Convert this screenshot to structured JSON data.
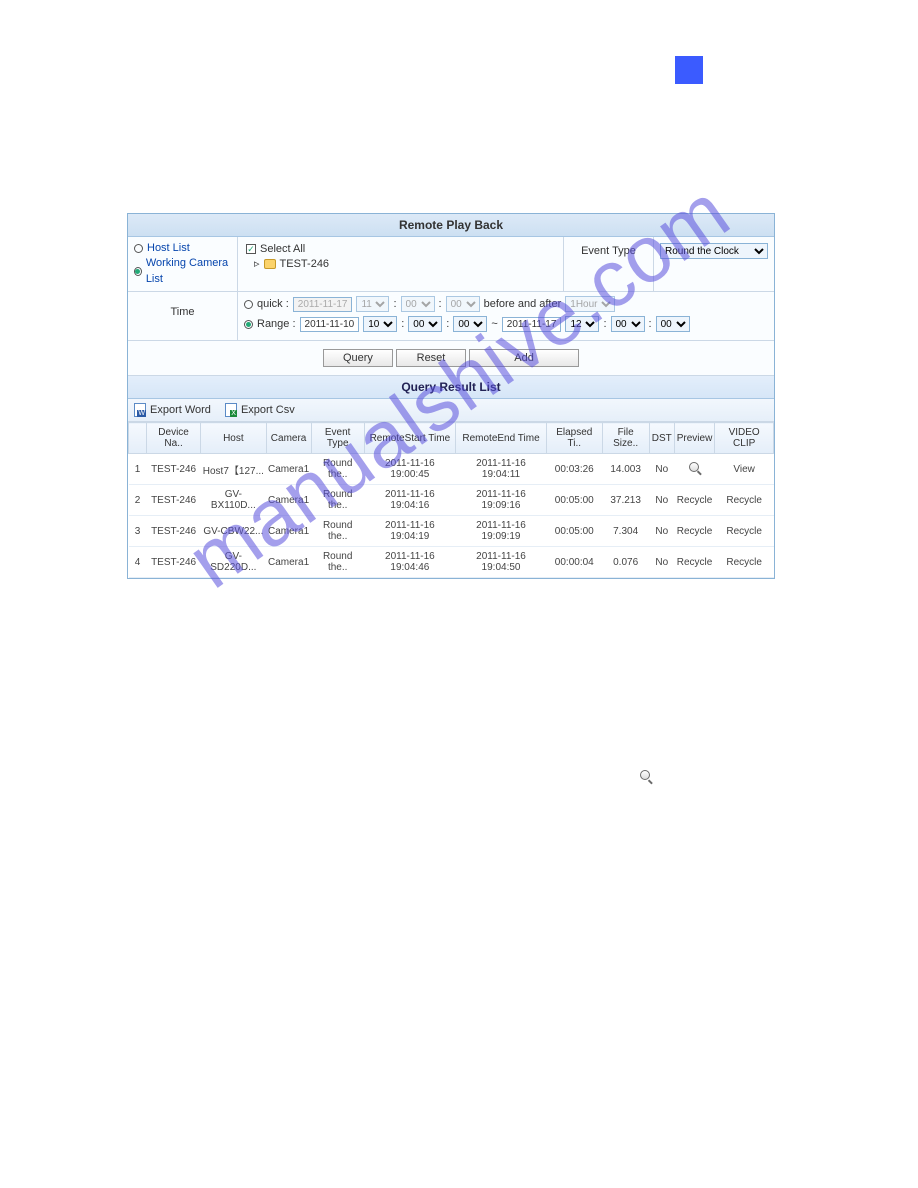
{
  "watermark_text": "manualshive.com",
  "header": {
    "title": "Remote Play Back"
  },
  "left": {
    "host_list": "Host List",
    "working_camera_list": "Working Camera List"
  },
  "tree": {
    "select_all": "Select All",
    "node": "TEST-246"
  },
  "event": {
    "label": "Event Type",
    "value": "Round the Clock"
  },
  "time": {
    "label": "Time",
    "quick": {
      "label": "quick :",
      "date": "2011-11-17",
      "h": "11",
      "m": "00",
      "s": "00",
      "ba": "before and after",
      "span": "1Hour"
    },
    "range": {
      "label": "Range :",
      "d1": "2011-11-10",
      "h1": "10",
      "m1": "00",
      "s1": "00",
      "d2": "2011-11-17",
      "h2": "12",
      "m2": "00",
      "s2": "00"
    }
  },
  "buttons": {
    "query": "Query",
    "reset": "Reset",
    "add": "Add"
  },
  "result": {
    "title": "Query Result List",
    "export_word": "Export Word",
    "export_csv": "Export Csv"
  },
  "cols": {
    "idx": "",
    "device": "Device Na..",
    "host": "Host",
    "camera": "Camera",
    "etype": "Event Type",
    "rstart": "RemoteStart Time",
    "rend": "RemoteEnd Time",
    "elapsed": "Elapsed Ti..",
    "fsize": "File Size..",
    "dst": "DST",
    "preview": "Preview",
    "clip": "VIDEO CLIP"
  },
  "rows": [
    {
      "i": "1",
      "device": "TEST-246",
      "host": "Host7【127...",
      "camera": "Camera1",
      "etype": "Round the..",
      "rstart": "2011-11-16 19:00:45",
      "rend": "2011-11-16 19:04:11",
      "elapsed": "00:03:26",
      "fsize": "14.003",
      "dst": "No",
      "preview": "icon",
      "clip": "View"
    },
    {
      "i": "2",
      "device": "TEST-246",
      "host": "GV-BX110D...",
      "camera": "Camera1",
      "etype": "Round the..",
      "rstart": "2011-11-16 19:04:16",
      "rend": "2011-11-16 19:09:16",
      "elapsed": "00:05:00",
      "fsize": "37.213",
      "dst": "No",
      "preview": "Recycle",
      "clip": "Recycle"
    },
    {
      "i": "3",
      "device": "TEST-246",
      "host": "GV-CBW22...",
      "camera": "Camera1",
      "etype": "Round the..",
      "rstart": "2011-11-16 19:04:19",
      "rend": "2011-11-16 19:09:19",
      "elapsed": "00:05:00",
      "fsize": "7.304",
      "dst": "No",
      "preview": "Recycle",
      "clip": "Recycle"
    },
    {
      "i": "4",
      "device": "TEST-246",
      "host": "GV-SD220D...",
      "camera": "Camera1",
      "etype": "Round the..",
      "rstart": "2011-11-16 19:04:46",
      "rend": "2011-11-16 19:04:50",
      "elapsed": "00:00:04",
      "fsize": "0.076",
      "dst": "No",
      "preview": "Recycle",
      "clip": "Recycle"
    }
  ]
}
